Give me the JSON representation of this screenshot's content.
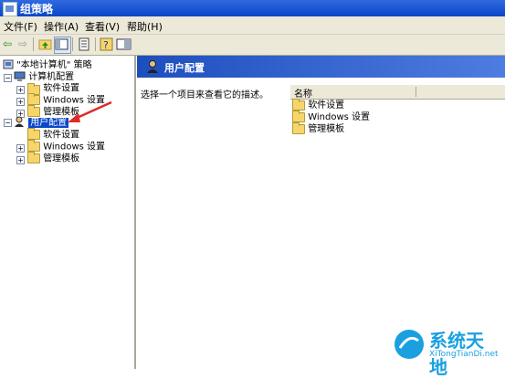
{
  "window": {
    "title": "组策略"
  },
  "menu": [
    "文件(F)",
    "操作(A)",
    "查看(V)",
    "帮助(H)"
  ],
  "tree": {
    "root": "\"本地计算机\" 策略",
    "computer": {
      "label": "计算机配置",
      "children": [
        "软件设置",
        "Windows 设置",
        "管理模板"
      ]
    },
    "user": {
      "label": "用户配置",
      "children": [
        "软件设置",
        "Windows 设置",
        "管理模板"
      ]
    }
  },
  "right": {
    "header": "用户配置",
    "description": "选择一个项目来查看它的描述。",
    "column_name": "名称",
    "items": [
      "软件设置",
      "Windows 设置",
      "管理模板"
    ]
  },
  "watermark": {
    "cn": "系统天地",
    "en": "XiTongTianDi.net"
  },
  "colors": {
    "title_bar": "#0a46c8",
    "selection": "#0a46c8",
    "folder": "#f6d66b",
    "annotation_arrow": "#e02a2a"
  }
}
